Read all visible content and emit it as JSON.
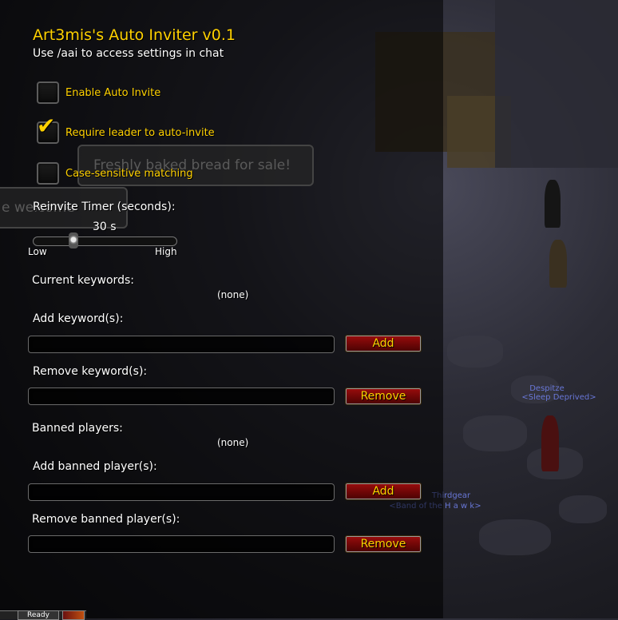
{
  "addon": {
    "title": "Art3mis's Auto Inviter v0.1",
    "subtitle": "Use /aai to access settings in chat"
  },
  "options": [
    {
      "label": "Enable Auto Invite",
      "checked": false
    },
    {
      "label": "Require leader to auto-invite",
      "checked": true
    },
    {
      "label": "Case-sensitive matching",
      "checked": false
    }
  ],
  "reinvite": {
    "label": "Reinvite Timer (seconds):",
    "value_text": "30 s",
    "value": 30,
    "min_label": "Low",
    "max_label": "High"
  },
  "keywords": {
    "current_label": "Current keywords:",
    "current_value": "(none)",
    "add_label": "Add keyword(s):",
    "add_button": "Add",
    "remove_label": "Remove keyword(s):",
    "remove_button": "Remove"
  },
  "banned": {
    "current_label": "Banned players:",
    "current_value": "(none)",
    "add_label": "Add banned player(s):",
    "add_button": "Add",
    "remove_label": "Remove banned player(s):",
    "remove_button": "Remove"
  },
  "world": {
    "bubble_text": "Freshly baked bread for sale!",
    "bubble2_text": "e welcome",
    "nameplates": [
      "Despitze",
      "<Sleep Deprived>",
      "Thirdgear",
      "<Band of the H a w k>"
    ]
  },
  "bottom_bar": {
    "ready_label": "Ready"
  },
  "colors": {
    "gold": "#ffd100",
    "button_red": "#8a0a0a",
    "nameplate_blue": "#6f7fe8"
  }
}
